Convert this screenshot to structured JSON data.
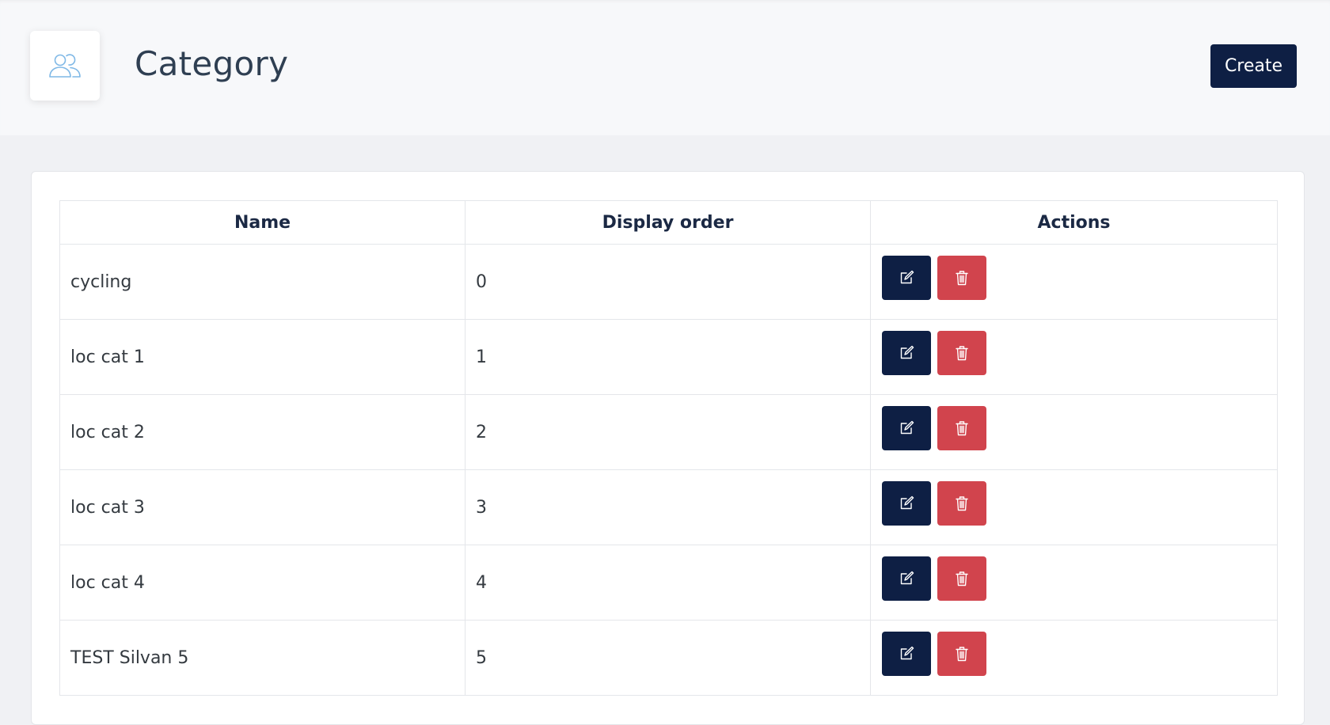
{
  "header": {
    "title": "Category",
    "icon": "users-icon",
    "create_label": "Create"
  },
  "table": {
    "columns": [
      "Name",
      "Display order",
      "Actions"
    ],
    "rows": [
      {
        "name": "cycling",
        "display_order": "0"
      },
      {
        "name": "loc cat 1",
        "display_order": "1"
      },
      {
        "name": "loc cat 2",
        "display_order": "2"
      },
      {
        "name": "loc cat 3",
        "display_order": "3"
      },
      {
        "name": "loc cat 4",
        "display_order": "4"
      },
      {
        "name": "TEST Silvan 5",
        "display_order": "5"
      }
    ],
    "row_actions": [
      "edit-icon",
      "trash-icon"
    ]
  },
  "colors": {
    "primary": "#0e1f44",
    "danger": "#d1444d",
    "icon_accent": "#7fb8e6"
  }
}
